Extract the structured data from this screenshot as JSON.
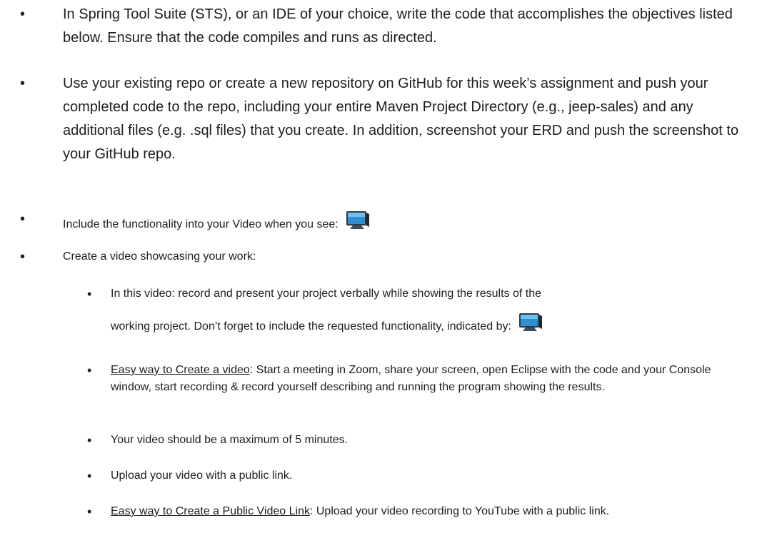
{
  "bullets": {
    "symbol": "•"
  },
  "items": [
    {
      "text": "In Spring Tool Suite (STS), or an IDE of your choice, write the code that accomplishes the objectives listed below. Ensure that the code compiles and runs as directed."
    },
    {
      "text": "Use your existing repo or create a new repository on GitHub for this week’s assignment and push your completed code to the repo, including your entire Maven Project Directory (e.g., jeep-sales) and any additional files (e.g. .sql files) that you create.  In addition, screenshot your ERD and push the screenshot to your GitHub repo."
    },
    {
      "text": "Include the functionality into your Video when you see:",
      "icon": "monitor-icon"
    },
    {
      "text": "Create a video showcasing your work:"
    }
  ],
  "subitems": [
    {
      "line1": "In this video: record and present your project verbally while showing the results of the",
      "line2": "working project.   Don’t forget to include the requested functionality, indicated by:",
      "icon": "monitor-icon"
    },
    {
      "link": "Easy way to Create a video",
      "text": ":  Start a meeting in Zoom, share your screen, open Eclipse with the code and your Console window, start recording & record yourself describing and running the program showing the results."
    },
    {
      "text": "Your video should be a maximum of 5 minutes."
    },
    {
      "text": "Upload your video with a public link."
    },
    {
      "link": "Easy way to Create a Public Video Link",
      "text": ":  Upload your video recording to YouTube with a public link."
    }
  ],
  "colors": {
    "text": "#1e1e1e",
    "monitor_screen": "#2f8fd0",
    "monitor_frame": "#2b3a48"
  }
}
